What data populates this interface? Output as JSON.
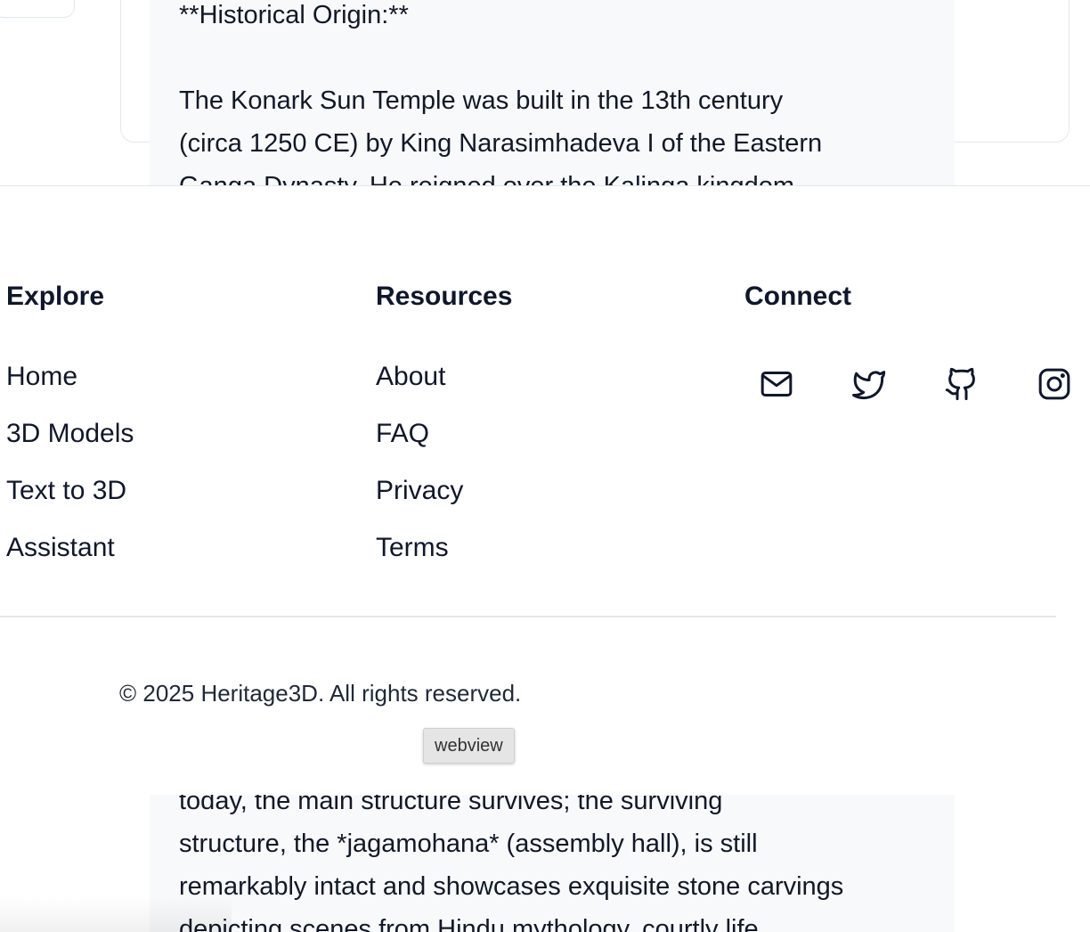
{
  "message": {
    "top_lines": [
      "**Historical Origin:**",
      "",
      "The Konark Sun Temple was built in the 13th century",
      "(circa 1250 CE) by King Narasimhadeva I of the Eastern",
      "Ganga Dynasty. He reigned over the Kalinga kingdom"
    ],
    "bottom_lines": [
      "today, the main structure survives; the surviving",
      "structure, the *jagamohana* (assembly hall), is still",
      "remarkably intact and showcases exquisite stone carvings",
      "depicting scenes from Hindu mythology, courtly life,"
    ]
  },
  "footer": {
    "explore": {
      "heading": "Explore",
      "links": [
        "Home",
        "3D Models",
        "Text to 3D",
        "Assistant"
      ]
    },
    "resources": {
      "heading": "Resources",
      "links": [
        "About",
        "FAQ",
        "Privacy",
        "Terms"
      ]
    },
    "connect": {
      "heading": "Connect",
      "icons": [
        "mail-icon",
        "twitter-icon",
        "github-icon",
        "instagram-icon"
      ]
    },
    "copyright": "© 2025 Heritage3D. All rights reserved."
  },
  "webview_label": "webview"
}
